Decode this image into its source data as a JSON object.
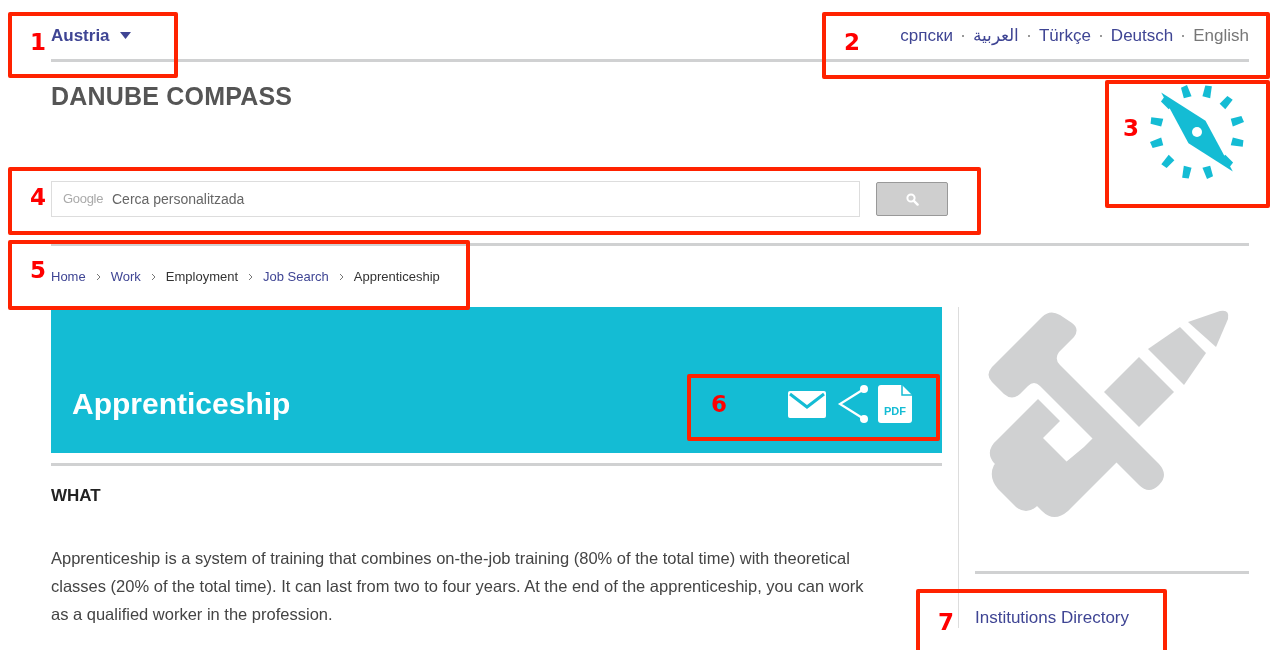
{
  "country_selector": {
    "label": "Austria"
  },
  "languages": [
    {
      "label": "српски",
      "selected": false
    },
    {
      "label": "العربية",
      "selected": false
    },
    {
      "label": "Türkçe",
      "selected": false
    },
    {
      "label": "Deutsch",
      "selected": false
    },
    {
      "label": "English",
      "selected": true
    }
  ],
  "site_title": "DANUBE COMPASS",
  "search": {
    "brand": "Google",
    "placeholder": "Cerca personalitzada"
  },
  "breadcrumb": [
    {
      "label": "Home",
      "link": true
    },
    {
      "label": "Work",
      "link": true
    },
    {
      "label": "Employment",
      "link": false
    },
    {
      "label": "Job Search",
      "link": true
    },
    {
      "label": "Apprenticeship",
      "link": false
    }
  ],
  "banner": {
    "title": "Apprenticeship",
    "pdf_label": "PDF"
  },
  "section_heading": "WHAT",
  "body_text": "Apprenticeship is a system of training that combines on-the-job training (80% of the total time) with theoretical classes (20% of the total time). It can last from two to four years. At the end of the apprenticeship, you can work as a qualified worker in the profession.",
  "sidebar": {
    "link": "Institutions Directory"
  },
  "annotations": [
    {
      "label": "1"
    },
    {
      "label": "2"
    },
    {
      "label": "3"
    },
    {
      "label": "4"
    },
    {
      "label": "5"
    },
    {
      "label": "6"
    },
    {
      "label": "7"
    }
  ]
}
